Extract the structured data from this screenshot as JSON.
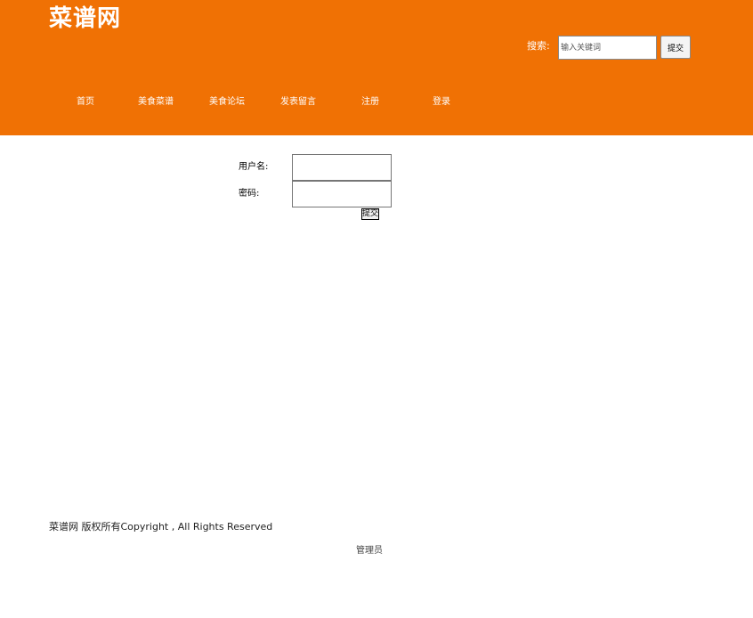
{
  "header": {
    "site_title": "菜谱网",
    "search_label": "搜索:",
    "search_placeholder": "输入关键词",
    "search_value": "",
    "search_submit": "提交",
    "accent_color": "#f07104"
  },
  "nav": {
    "items": [
      {
        "label": "首页"
      },
      {
        "label": "美食菜谱"
      },
      {
        "label": "美食论坛"
      },
      {
        "label": "发表留言"
      },
      {
        "label": "注册"
      },
      {
        "label": "登录"
      }
    ]
  },
  "login_form": {
    "username_label": "用户名:",
    "username_value": "",
    "password_label": "密码:",
    "password_value": "",
    "submit_label": "提交"
  },
  "footer": {
    "copyright": "菜谱网 版权所有Copyright , All Rights Reserved",
    "admin_link": "管理员"
  }
}
